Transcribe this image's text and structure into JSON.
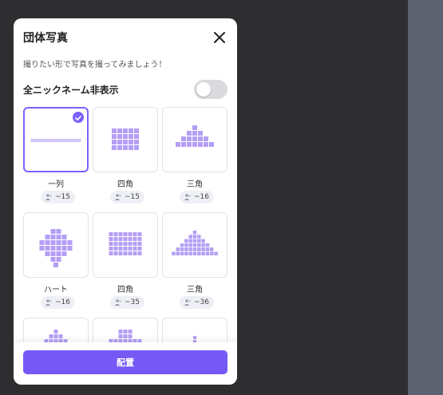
{
  "modal": {
    "title": "団体写真",
    "subtitle": "撮りたい形で写真を撮ってみましょう！",
    "toggle_label": "全ニックネーム非表示",
    "toggle_on": false
  },
  "colors": {
    "accent": "#7659f5",
    "tile": "#b49ef5",
    "backdrop": "#2e2e30"
  },
  "formations": [
    {
      "label": "一列",
      "capacity": "~15",
      "selected": true,
      "shape": "row"
    },
    {
      "label": "四角",
      "capacity": "~15",
      "selected": false,
      "shape": "square-small"
    },
    {
      "label": "三角",
      "capacity": "~16",
      "selected": false,
      "shape": "triangle-small"
    },
    {
      "label": "ハート",
      "capacity": "~16",
      "selected": false,
      "shape": "heart"
    },
    {
      "label": "四角",
      "capacity": "~35",
      "selected": false,
      "shape": "square-large"
    },
    {
      "label": "三角",
      "capacity": "~36",
      "selected": false,
      "shape": "triangle-large"
    }
  ],
  "footer": {
    "button_label": "配置"
  }
}
